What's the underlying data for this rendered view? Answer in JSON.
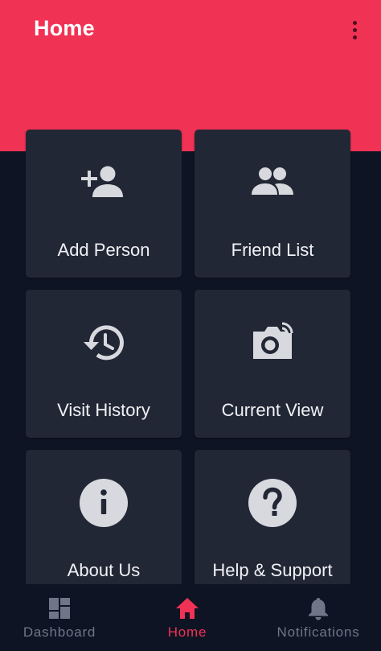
{
  "app_bar": {
    "title": "Home"
  },
  "colors": {
    "accent": "#f03254",
    "background": "#0f1424",
    "card": "#222736",
    "icon": "#d8d9de",
    "nav_inactive": "#6f7687"
  },
  "tiles": [
    {
      "label": "Add Person",
      "icon": "person-add-icon"
    },
    {
      "label": "Friend List",
      "icon": "group-icon"
    },
    {
      "label": "Visit History",
      "icon": "history-icon"
    },
    {
      "label": "Current View",
      "icon": "camera-icon"
    },
    {
      "label": "About Us",
      "icon": "info-icon"
    },
    {
      "label": "Help & Support",
      "icon": "help-icon"
    }
  ],
  "bottom_nav": {
    "selected": "Home",
    "items": [
      {
        "label": "Dashboard",
        "icon": "dashboard-icon"
      },
      {
        "label": "Home",
        "icon": "home-icon"
      },
      {
        "label": "Notifications",
        "icon": "bell-icon"
      }
    ]
  }
}
